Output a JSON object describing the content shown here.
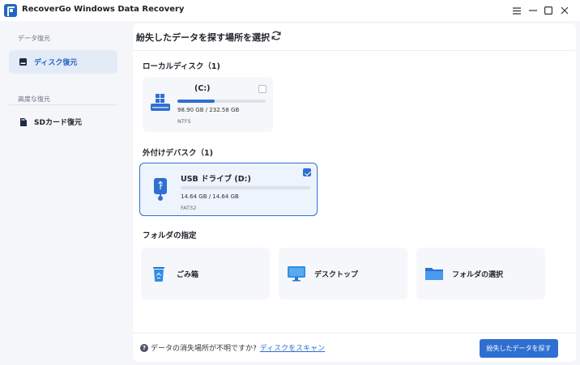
{
  "window": {
    "title": "RecoverGo Windows Data Recovery",
    "controls": [
      "menu-icon",
      "minimize-icon",
      "maximize-icon",
      "close-icon"
    ]
  },
  "sidebar": {
    "section1_title": "データ復元",
    "section2_title": "高度な復元",
    "items": [
      {
        "label": "ディスク復元",
        "icon": "drive-icon",
        "active": true
      },
      {
        "label": "SDカード復元",
        "icon": "sd-card-icon",
        "active": false
      }
    ]
  },
  "main": {
    "title": "紛失したデータを探す場所を選択",
    "local_disk": {
      "title": "ローカルディスク（1)",
      "drives": [
        {
          "name": "(C:)",
          "size": "98.90 GB / 232.58 GB",
          "fs": "NTFS",
          "used_fraction": 0.425,
          "checked": false
        }
      ]
    },
    "external_device": {
      "title": "外付けデバスク（1)",
      "drives": [
        {
          "name": "USB ドライブ (D:)",
          "size": "14.64 GB / 14.64 GB",
          "fs": "FAT32",
          "used_fraction": 0.0,
          "checked": true
        }
      ]
    },
    "folder": {
      "title": "フォルダの指定",
      "items": [
        {
          "label": "ごみ箱",
          "icon": "recycle-bin-icon"
        },
        {
          "label": "デスクトップ",
          "icon": "desktop-icon"
        },
        {
          "label": "フォルダの選択",
          "icon": "folder-icon"
        }
      ]
    },
    "footer": {
      "help_text": "データの消失場所が不明ですか?",
      "help_link": "ディスクをスキャン",
      "primary_button": "紛失したデータを探す"
    }
  },
  "colors": {
    "accent": "#2f6fd1",
    "sidebar_active_bg": "#e3ebf7"
  }
}
